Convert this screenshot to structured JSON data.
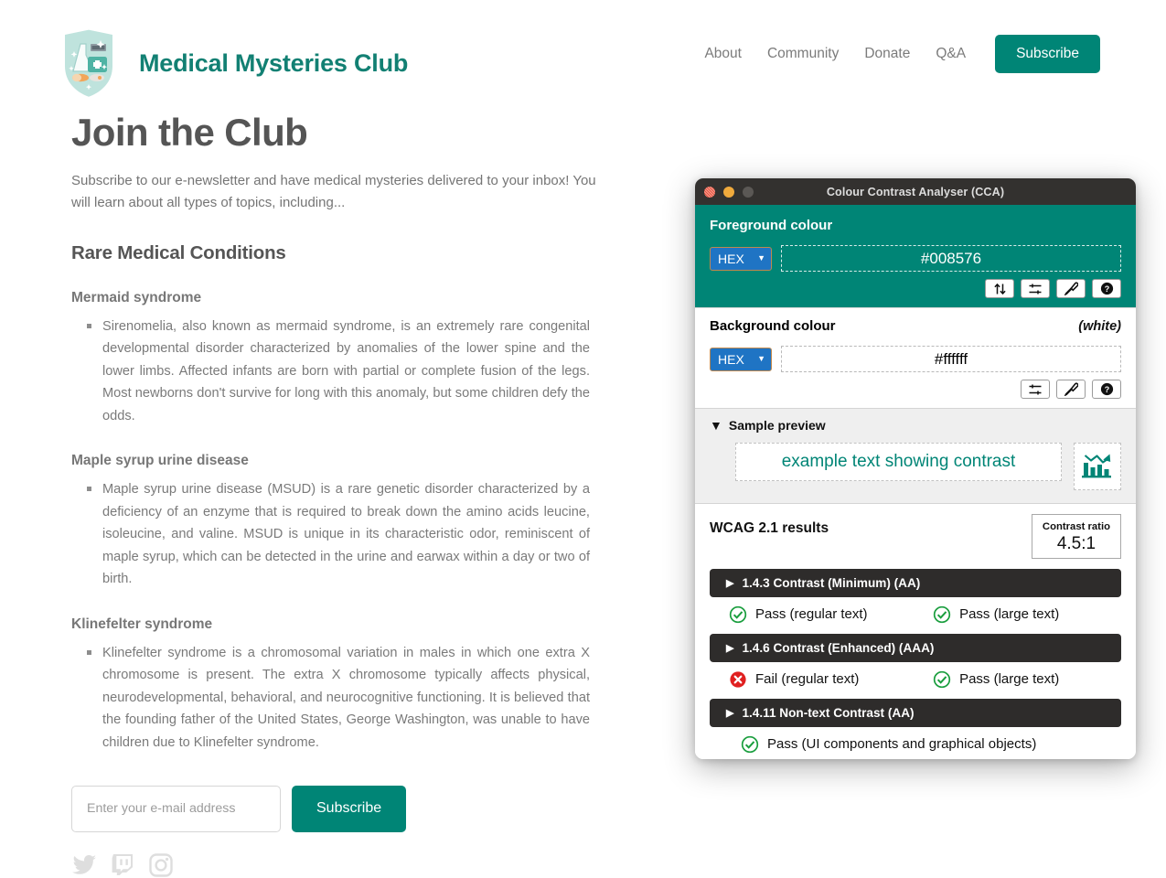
{
  "header": {
    "logo_icon": "medical-shield-badge-icon",
    "brand_title": "Medical Mysteries Club",
    "nav": [
      {
        "label": "About"
      },
      {
        "label": "Community"
      },
      {
        "label": "Donate"
      },
      {
        "label": "Q&A"
      }
    ],
    "subscribe_label": "Subscribe",
    "accent_color": "#008576",
    "nav_text_color": "#7b7b7b"
  },
  "main": {
    "page_title": "Join the Club",
    "intro": "Subscribe to our e-newsletter and have medical mysteries delivered to your inbox! You will learn about all types of topics, including...",
    "section_heading": "Rare Medical Conditions",
    "conditions": [
      {
        "name": "Mermaid syndrome",
        "body": "Sirenomelia, also known as mermaid syndrome, is an extremely rare congenital developmental disorder characterized by anomalies of the lower spine and the lower limbs. Affected infants are born with partial or complete fusion of the legs. Most newborns don't survive for long with this anomaly, but some children defy the odds."
      },
      {
        "name": "Maple syrup urine disease",
        "body": "Maple syrup urine disease (MSUD) is a rare genetic disorder characterized by a deficiency of an enzyme that is required to break down the amino acids leucine, isoleucine, and valine. MSUD is unique in its characteristic odor, reminiscent of maple syrup, which can be detected in the urine and earwax within a day or two of birth."
      },
      {
        "name": "Klinefelter syndrome",
        "body": "Klinefelter syndrome is a chromosomal variation in males in which one extra X chromosome is present. The extra X chromosome typically affects physical, neurodevelopmental, behavioral, and neurocognitive functioning. It is believed that the founding father of the United States, George Washington, was unable to have children due to Klinefelter syndrome."
      }
    ],
    "form": {
      "email_placeholder": "Enter your e-mail address",
      "email_value": "",
      "submit_label": "Subscribe"
    },
    "socials": [
      {
        "name": "twitter-icon"
      },
      {
        "name": "twitch-icon"
      },
      {
        "name": "instagram-icon"
      }
    ],
    "social_color": "#dedede"
  },
  "cca": {
    "window_title": "Colour Contrast Analyser (CCA)",
    "traffic_lights": [
      "close-red",
      "minimize-amber",
      "zoom-grey"
    ],
    "foreground": {
      "label": "Foreground colour",
      "format": "HEX",
      "value": "#008576",
      "panel_color": "#008576",
      "buttons": [
        {
          "name": "swap-colours-icon"
        },
        {
          "name": "sliders-icon"
        },
        {
          "name": "eyedropper-icon"
        },
        {
          "name": "help-icon"
        }
      ]
    },
    "background": {
      "label": "Background colour",
      "note": "(white)",
      "format": "HEX",
      "value": "#ffffff",
      "buttons": [
        {
          "name": "sliders-icon"
        },
        {
          "name": "eyedropper-icon"
        },
        {
          "name": "help-icon"
        }
      ]
    },
    "sample_preview": {
      "heading": "Sample preview",
      "expanded": true,
      "sample_text": "example text showing contrast",
      "graphic_icon": "bar-chart-declining-icon"
    },
    "results": {
      "title": "WCAG 2.1 results",
      "ratio_label": "Contrast ratio",
      "ratio_value": "4.5:1",
      "criteria": [
        {
          "name": "1.4.3 Contrast (Minimum) (AA)",
          "results": [
            {
              "status": "pass",
              "label": "Pass (regular text)"
            },
            {
              "status": "pass",
              "label": "Pass (large text)"
            }
          ]
        },
        {
          "name": "1.4.6 Contrast (Enhanced) (AAA)",
          "results": [
            {
              "status": "fail",
              "label": "Fail (regular text)"
            },
            {
              "status": "pass",
              "label": "Pass (large text)"
            }
          ]
        },
        {
          "name": "1.4.11 Non-text Contrast (AA)",
          "results": [
            {
              "status": "pass",
              "label": "Pass (UI components and graphical objects)"
            }
          ]
        }
      ],
      "pass_color": "#1a9e3e",
      "fail_color": "#e02020"
    }
  }
}
